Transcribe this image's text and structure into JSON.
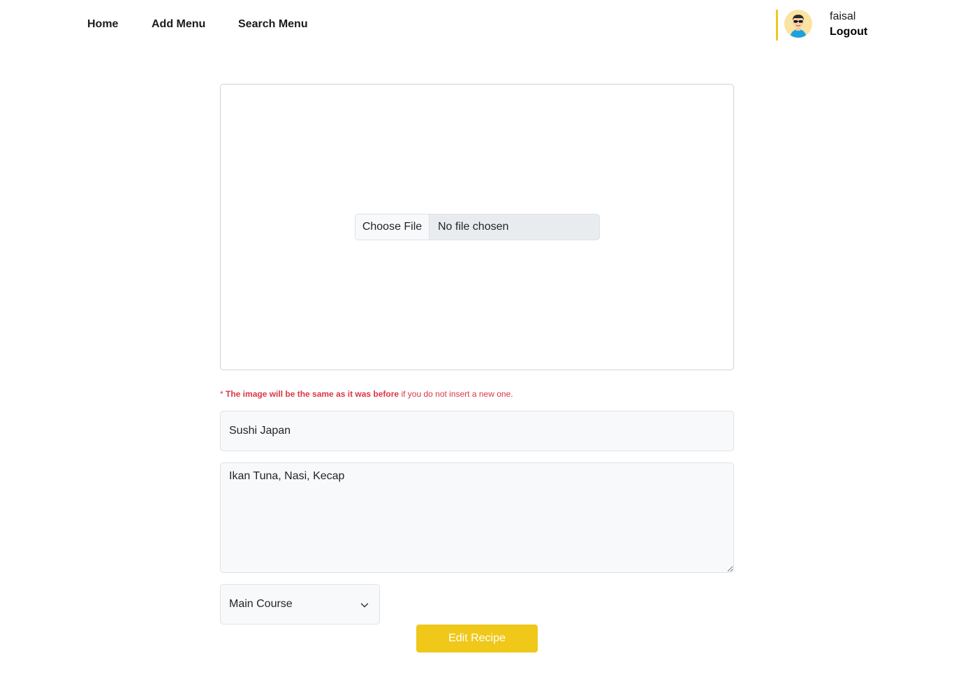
{
  "nav": {
    "items": [
      {
        "label": "Home"
      },
      {
        "label": "Add Menu"
      },
      {
        "label": "Search Menu"
      }
    ]
  },
  "profile": {
    "username": "faisal",
    "logout_label": "Logout",
    "avatar_icon": "user-avatar-icon"
  },
  "upload": {
    "button_label": "Choose File",
    "status_text": "No file chosen"
  },
  "note": {
    "asterisk": "* ",
    "bold_text": "The image will be the same as it was before",
    "rest_text": " if you do not insert a new one."
  },
  "form": {
    "title_value": "Sushi Japan",
    "ingredients_value": "Ikan Tuna, Nasi, Kecap",
    "category_selected": "Main Course",
    "submit_label": "Edit Recipe"
  },
  "colors": {
    "accent": "#efc81a",
    "error": "#dc3545"
  }
}
